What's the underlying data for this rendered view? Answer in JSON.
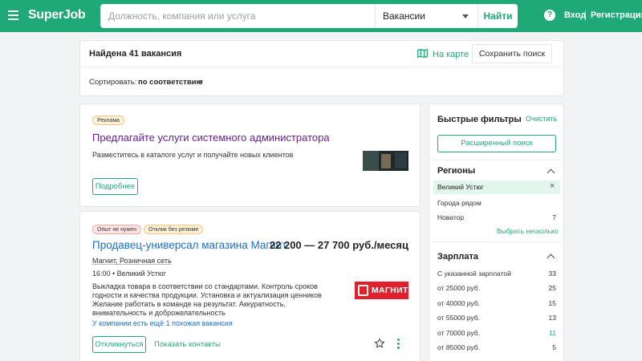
{
  "header": {
    "logo": "SuperJob",
    "search_placeholder": "Должность, компания или услуга",
    "search_type": "Вакансии",
    "find_label": "Найти",
    "help_symbol": "?",
    "login": "Вход",
    "register": "Регистрация"
  },
  "results": {
    "found_text": "Найдена 41 вакансия",
    "map_label": "На карте",
    "save_search": "Сохранить поиск",
    "sort_label": "Сортировать:",
    "sort_value": "по соответствию"
  },
  "ad": {
    "badge": "Реклама",
    "title": "Предлагайте услуги системного администратора",
    "description": "Разместитесь в каталоге услуг и получайте новых клиентов",
    "button": "Подробнее"
  },
  "vacancy": {
    "badges": [
      "Опыт не нужен",
      "Отклик без резюме"
    ],
    "title": "Продавец-универсал магазина Магнит",
    "salary": "22 200 — 27 700 руб./месяц",
    "company": "Магнит, Розничная сеть",
    "time_location": "16:00 • Великий Устюг",
    "description": "Выкладка товара в соответствии со стандартами. Контроль сроков годности и качества продукции. Установка и актуализация ценников Желание работать в команде на результат. Аккуратность, внимательность и доброжелательность",
    "company_logo_text": "МАГНИТ",
    "similar_link": "У компании есть ещё 1 похожая вакансия",
    "respond_label": "Откликнуться",
    "contacts_label": "Показать контакты"
  },
  "filters": {
    "title": "Быстрые фильтры",
    "clear": "Очистить",
    "advanced": "Расширенный поиск",
    "regions": {
      "title": "Регионы",
      "selected": "Великий Устюг",
      "nearby": "Города рядом",
      "items": [
        {
          "label": "Новатор",
          "count": "7"
        }
      ],
      "pick_more": "Выбрать несколько"
    },
    "salary": {
      "title": "Зарплата",
      "items": [
        {
          "label": "С указанной зарплатой",
          "count": "33"
        },
        {
          "label": "от 25000 руб.",
          "count": "25"
        },
        {
          "label": "от 40000 руб.",
          "count": "15"
        },
        {
          "label": "от 55000 руб.",
          "count": "13"
        },
        {
          "label": "от 70000 руб.",
          "count": "11"
        },
        {
          "label": "от 85000 руб.",
          "count": "5"
        }
      ]
    }
  },
  "colors": {
    "brand_green": "#1ea976",
    "link_blue": "#1a6fc9",
    "ad_purple": "#66208f",
    "magnit_red": "#e0202b"
  }
}
